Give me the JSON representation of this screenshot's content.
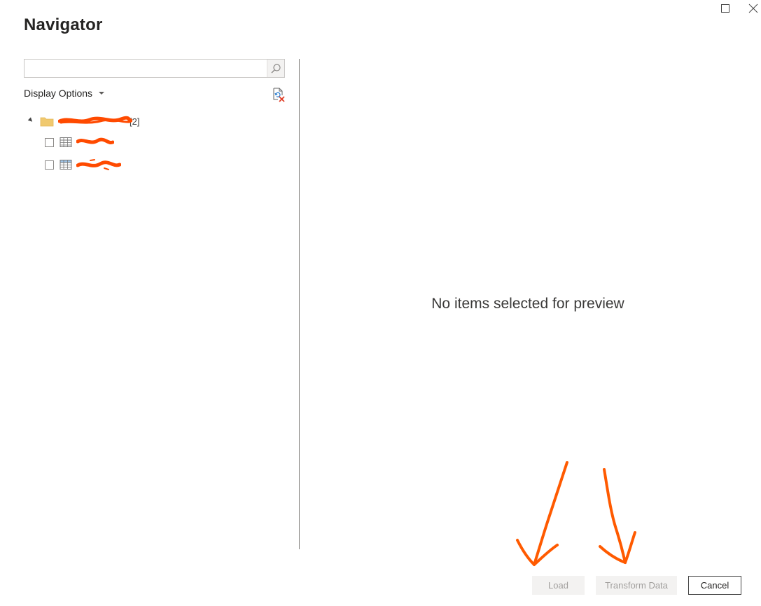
{
  "window": {
    "title": "Navigator",
    "maximize_icon": "maximize-icon",
    "close_icon": "close-icon"
  },
  "search": {
    "value": "",
    "placeholder": "",
    "icon": "search-icon"
  },
  "display_options": {
    "label": "Display Options",
    "icon": "chevron-down-icon"
  },
  "refresh": {
    "icon": "refresh-icon"
  },
  "tree": {
    "root": {
      "icon": "folder-icon",
      "label_redacted": true,
      "count": "[2]"
    },
    "items": [
      {
        "icon": "table-icon",
        "checked": false,
        "label_redacted": true
      },
      {
        "icon": "table-icon",
        "checked": false,
        "label_redacted": true
      }
    ]
  },
  "preview": {
    "empty_message": "No items selected for preview"
  },
  "footer": {
    "load_label": "Load",
    "transform_label": "Transform Data",
    "cancel_label": "Cancel"
  },
  "colors": {
    "annotation": "#ff5a00",
    "disabled_button_bg": "#f3f2f1",
    "disabled_button_text": "#a19f9d",
    "folder": "#f0c96f"
  }
}
